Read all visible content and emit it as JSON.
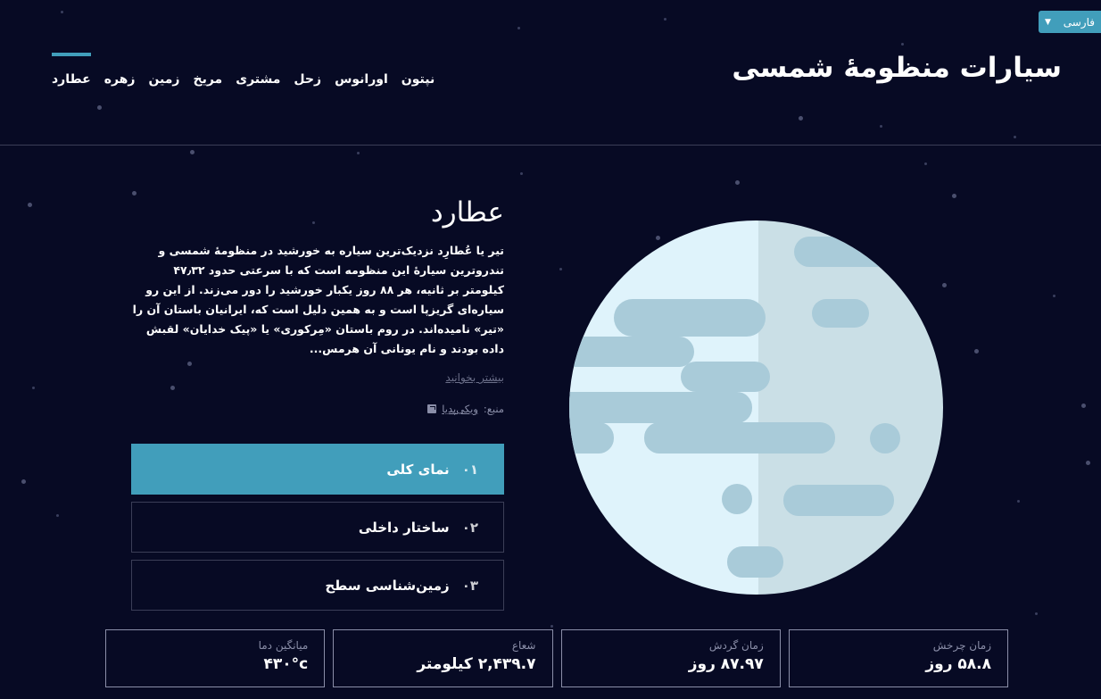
{
  "language": {
    "selected": "فارسی"
  },
  "header": {
    "title": "سیارات منظومهٔ شمسی",
    "nav": [
      "عطارد",
      "زهره",
      "زمین",
      "مریخ",
      "مشتری",
      "زحل",
      "اورانوس",
      "نپتون"
    ],
    "active_nav": "عطارد"
  },
  "planet": {
    "name": "عطارد",
    "description": "تیر یا عُطارِد نزدیک‌ترین سیاره به خورشید در منظومهٔ شمسی و تندروترین سیارهٔ این منظومه است که با سرعتی حدود ۴۷٫۳۲ کیلومتر بر ثانیه، هر ۸۸ روز یکبار خورشید را دور می‌زند. از این رو سیاره‌ای گریزپا است و به همین دلیل است که، ایرانیان باستان آن را «تیر» نامیده‌اند. در روم باستان «مِرکوری» یا «پیک خدایان» لقبش داده بودند و نام یونانی آن هرمس...",
    "read_more": "بیشتر بخوانید",
    "source_label": "منبع:",
    "source_link": "ویکی‌پدیا",
    "colors": {
      "light": "#dff3fb",
      "shade": "#cadfe6",
      "band": "#a9cbd9",
      "accent": "#419ebb"
    }
  },
  "tabs": [
    {
      "num": "۰۱",
      "label": "نمای کلی",
      "active": true
    },
    {
      "num": "۰۲",
      "label": "ساختار داخلی",
      "active": false
    },
    {
      "num": "۰۳",
      "label": "زمین‌شناسی سطح",
      "active": false
    }
  ],
  "stats": [
    {
      "label": "زمان چرخش",
      "value": "۵۸.۸ روز"
    },
    {
      "label": "زمان گردش",
      "value": "۸۷.۹۷ روز"
    },
    {
      "label": "شعاع",
      "value": "۲,۴۳۹.۷ کیلومتر"
    },
    {
      "label": "میانگین دما",
      "value": "۴۳۰°c"
    }
  ]
}
